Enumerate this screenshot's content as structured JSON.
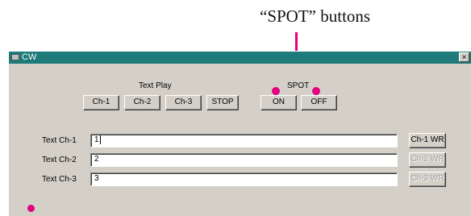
{
  "annotation": {
    "callout_text": "“SPOT” buttons",
    "color": "#e4007f"
  },
  "window": {
    "title": "CW",
    "close_label": "×",
    "titlebar_color": "#1f7a7a"
  },
  "text_play": {
    "label": "Text Play",
    "buttons": [
      "Ch-1",
      "Ch-2",
      "Ch-3",
      "STOP"
    ]
  },
  "spot": {
    "label": "SPOT",
    "on_label": "ON",
    "off_label": "OFF"
  },
  "text_rows": [
    {
      "label": "Text Ch-1",
      "value": "1",
      "write_label": "Ch-1 WR",
      "write_enabled": true
    },
    {
      "label": "Text Ch-2",
      "value": "2",
      "write_label": "Ch-2 WR",
      "write_enabled": false
    },
    {
      "label": "Text Ch-3",
      "value": "3",
      "write_label": "Ch-3 WR",
      "write_enabled": false
    }
  ]
}
